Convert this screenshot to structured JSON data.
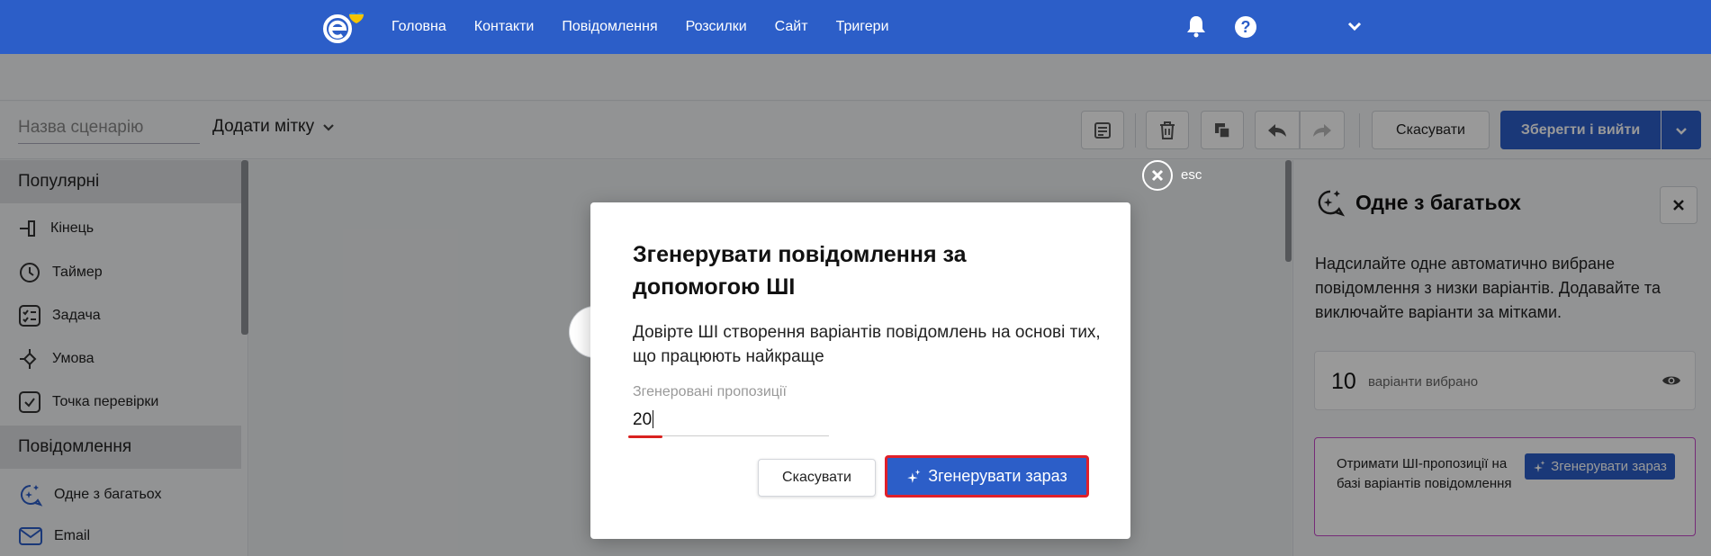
{
  "nav": {
    "links": [
      "Головна",
      "Контакти",
      "Повідомлення",
      "Розсилки",
      "Сайт",
      "Тригери"
    ],
    "help_glyph": "?",
    "icons": [
      "logo",
      "bell-icon",
      "help-icon",
      "chevron-down-icon"
    ]
  },
  "toolbar": {
    "scenario_placeholder": "Назва сценарію",
    "add_tag_label": "Додати мітку",
    "cancel_label": "Скасувати",
    "save_label": "Зберегти і вийти",
    "icons": [
      "note-icon",
      "trash-icon",
      "copy-icon",
      "undo-icon",
      "redo-icon",
      "chevron-down-icon"
    ]
  },
  "sidebar": {
    "popular_header": "Популярні",
    "popular_items": [
      {
        "label": "Кінець",
        "icon": "end-icon"
      },
      {
        "label": "Таймер",
        "icon": "timer-icon"
      },
      {
        "label": "Задача",
        "icon": "task-icon"
      },
      {
        "label": "Умова",
        "icon": "condition-icon"
      },
      {
        "label": "Точка перевірки",
        "icon": "checkpoint-icon"
      }
    ],
    "messages_header": "Повідомлення",
    "messages_items": [
      {
        "label": "Одне з багатьох",
        "icon": "sparkle-chat-icon"
      },
      {
        "label": "Email",
        "icon": "email-icon"
      }
    ]
  },
  "canvas": {
    "esc_label": "esc"
  },
  "right_panel": {
    "title": "Одне з багатьох",
    "description": "Надсилайте одне автоматично вибране повідомлення з низки варіантів. Додавайте та виключайте варіанти за мітками.",
    "variants_count": "10",
    "variants_label": "варіанти вибрано",
    "ai_text": "Отримати ШІ-пропозиції на базі варіантів повідомлення",
    "ai_button": "Згенерувати зараз"
  },
  "modal": {
    "title": "Згенерувати повідомлення за допомогою ШІ",
    "description": "Довірте ШІ створення варіантів повідомлень на основі тих, що працюють найкраще",
    "field_label": "Згенеровані пропозиції",
    "field_value": "20",
    "cancel_label": "Скасувати",
    "generate_label": "Згенерувати зараз"
  },
  "colors": {
    "brand_blue": "#2c5ec8",
    "highlight_red": "#e0202a",
    "ai_border": "#c548c9",
    "logo_yellow": "#f5c400"
  }
}
